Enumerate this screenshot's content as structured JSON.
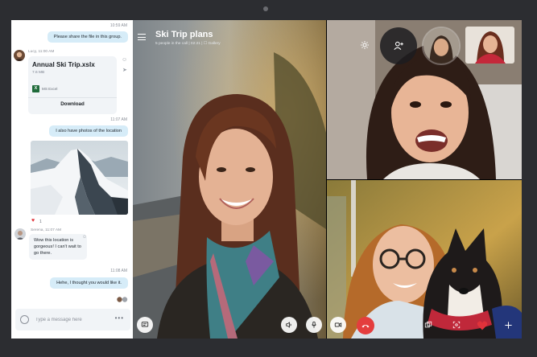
{
  "chat": {
    "time_1": "10:59 AM",
    "message_1": "Please share the file in this group.",
    "sender_1": "Lucy, 11:00 AM",
    "file": {
      "name": "Annual Ski Trip.xslx",
      "size": "7.6 MB",
      "type_icon": "X",
      "type": "MS Excel",
      "download_label": "Download"
    },
    "time_2": "11:07 AM",
    "message_2": "I also have photos of the location",
    "reaction_icon": "heart-icon",
    "reaction_count": "1",
    "sender_2": "Serena, 11:07 AM",
    "message_3": "Wow this location is gorgeous! I can't wait to go there.",
    "time_3": "11:08 AM",
    "message_4": "Hehe, I thought you would like it.",
    "composer": {
      "placeholder": "Type a message here",
      "more_label": "•••"
    }
  },
  "call": {
    "title": "Ski Trip plans",
    "subtitle": "5 people in the call  |  02:21  |  ☐  Gallery"
  },
  "colors": {
    "outgoing_bubble": "#d6ecf8",
    "incoming_bubble": "#f1f4f7",
    "hangup": "#e43d3d",
    "heart": "#e0323a"
  }
}
